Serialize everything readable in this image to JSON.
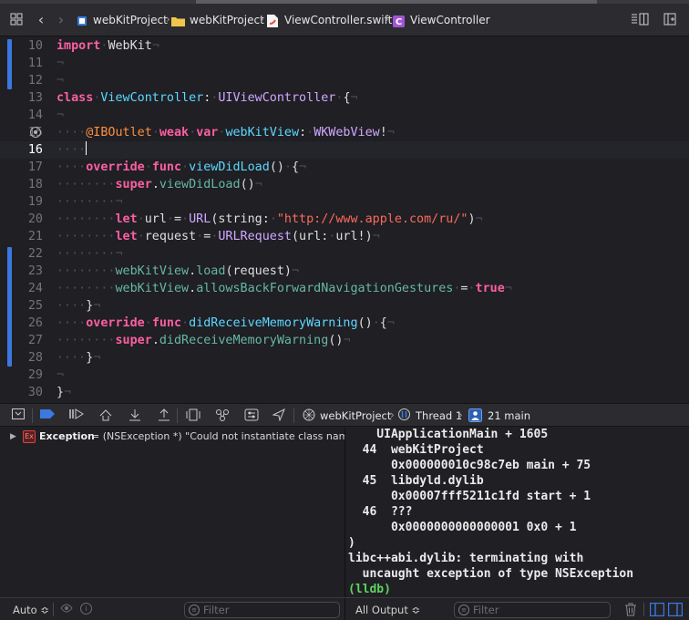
{
  "breadcrumbs": [
    "webKitProject",
    "webKitProject",
    "ViewController.swift",
    "ViewController"
  ],
  "editor": {
    "lines": [
      {
        "n": "10",
        "html": "<span class=\"kw\">import</span><span class=\"inv\">·</span>WebKit<span class=\"inv\">¬</span>"
      },
      {
        "n": "11",
        "html": "<span class=\"inv\">¬</span>"
      },
      {
        "n": "12",
        "html": "<span class=\"inv\">¬</span>"
      },
      {
        "n": "13",
        "html": "<span class=\"kw\">class</span><span class=\"inv\">·</span><span class=\"ty\">ViewController</span>:<span class=\"inv\">·</span><span class=\"tyo\">UIViewController</span><span class=\"inv\">·</span>{<span class=\"inv\">¬</span>"
      },
      {
        "n": "14",
        "html": "<span class=\"inv\">¬</span>"
      },
      {
        "n": "15",
        "html": "<span class=\"inv\">····</span><span class=\"attr\">@IBOutlet</span><span class=\"inv\">·</span><span class=\"kw\">weak</span><span class=\"inv\">·</span><span class=\"kw\">var</span><span class=\"inv\">·</span><span class=\"ty\">webKitView</span>:<span class=\"inv\">·</span><span class=\"tyo\">WKWebView</span>!<span class=\"inv\">¬</span>"
      },
      {
        "n": "16",
        "html": "<span class=\"inv\">····</span><span class=\"caret\"></span>"
      },
      {
        "n": "17",
        "html": "<span class=\"inv\">····</span><span class=\"kw\">override</span><span class=\"inv\">·</span><span class=\"kw\">func</span><span class=\"inv\">·</span><span class=\"ty\">viewDidLoad</span>()<span class=\"inv\">·</span>{<span class=\"inv\">¬</span>"
      },
      {
        "n": "18",
        "html": "<span class=\"inv\">········</span><span class=\"kw\">super</span>.<span class=\"fn\">viewDidLoad</span>()<span class=\"inv\">¬</span>"
      },
      {
        "n": "19",
        "html": "<span class=\"inv\">········¬</span>"
      },
      {
        "n": "20",
        "html": "<span class=\"inv\">········</span><span class=\"kw\">let</span><span class=\"inv\">·</span>url<span class=\"inv\">·</span>=<span class=\"inv\">·</span><span class=\"tyo\">URL</span>(string:<span class=\"inv\">·</span><span class=\"str\">\"http://www.apple.com/ru/\"</span>)<span class=\"inv\">¬</span>"
      },
      {
        "n": "21",
        "html": "<span class=\"inv\">········</span><span class=\"kw\">let</span><span class=\"inv\">·</span>request<span class=\"inv\">·</span>=<span class=\"inv\">·</span><span class=\"tyo\">URLRequest</span>(url:<span class=\"inv\">·</span>url!)<span class=\"inv\">¬</span>"
      },
      {
        "n": "22",
        "html": "<span class=\"inv\">········¬</span>"
      },
      {
        "n": "23",
        "html": "<span class=\"inv\">········</span><span class=\"fn\">webKitView</span>.<span class=\"fn\">load</span>(request)<span class=\"inv\">¬</span>"
      },
      {
        "n": "24",
        "html": "<span class=\"inv\">········</span><span class=\"fn\">webKitView</span>.<span class=\"fn\">allowsBackForwardNavigationGestures</span><span class=\"inv\">·</span>=<span class=\"inv\">·</span><span class=\"kw\">true</span><span class=\"inv\">¬</span>"
      },
      {
        "n": "25",
        "html": "<span class=\"inv\">····</span>}<span class=\"inv\">¬</span>"
      },
      {
        "n": "26",
        "html": "<span class=\"inv\">····</span><span class=\"kw\">override</span><span class=\"inv\">·</span><span class=\"kw\">func</span><span class=\"inv\">·</span><span class=\"ty\">didReceiveMemoryWarning</span>()<span class=\"inv\">·</span>{<span class=\"inv\">¬</span>"
      },
      {
        "n": "27",
        "html": "<span class=\"inv\">········</span><span class=\"kw\">super</span>.<span class=\"fn\">didReceiveMemoryWarning</span>()<span class=\"inv\">¬</span>"
      },
      {
        "n": "28",
        "html": "<span class=\"inv\">····</span>}<span class=\"inv\">¬</span>"
      },
      {
        "n": "29",
        "html": "<span class=\"inv\">¬</span>"
      },
      {
        "n": "30",
        "html": "}<span class=\"inv\">¬</span>"
      }
    ],
    "current_line": "16",
    "breakpoint_line": "15"
  },
  "debugbar": {
    "project": "webKitProject",
    "thread": "Thread 1",
    "frame": "21 main"
  },
  "variables": {
    "name": "Exception",
    "badge": "Ex",
    "value": "= (NSException *) \"Could not instantiate class named..."
  },
  "console": {
    "lines": [
      "    UIApplicationMain + 1605",
      "  44  webKitProject",
      "      0x000000010c98c7eb main + 75",
      "  45  libdyld.dylib",
      "      0x00007fff5211c1fd start + 1",
      "  46  ???",
      "      0x0000000000000001 0x0 + 1",
      ")",
      "libc++abi.dylib: terminating with",
      "  uncaught exception of type NSException",
      "(lldb)"
    ]
  },
  "bottom": {
    "auto_label": "Auto ≎",
    "filter_placeholder": "Filter",
    "output_label": "All Output ≎",
    "console_filter_placeholder": "Filter"
  },
  "colors": {
    "lldb": "#5fd35f",
    "accent": "#3b78e0"
  }
}
